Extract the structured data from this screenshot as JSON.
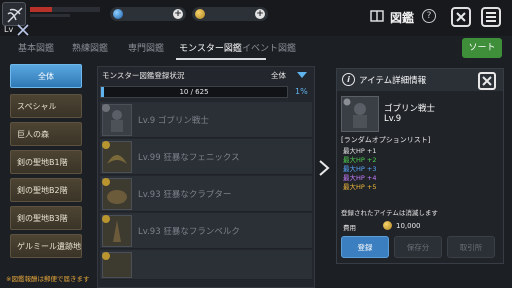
{
  "player": {
    "level_label": "Lv",
    "hp_fraction": 0.32
  },
  "header": {
    "title": "図鑑",
    "help_label": "?"
  },
  "tabs": [
    {
      "label": "基本図鑑"
    },
    {
      "label": "熟練図鑑"
    },
    {
      "label": "専門図鑑"
    },
    {
      "label": "モンスター図鑑"
    },
    {
      "label": "イベント図鑑"
    }
  ],
  "sort_label": "ソート",
  "sidebar": {
    "items": [
      {
        "label": "全体"
      },
      {
        "label": "スペシャル"
      },
      {
        "label": "巨人の森"
      },
      {
        "label": "剣の聖地B1階"
      },
      {
        "label": "剣の聖地B2階"
      },
      {
        "label": "剣の聖地B3階"
      },
      {
        "label": "ゲルミール遺跡地"
      }
    ]
  },
  "collection": {
    "status_label": "モンスター図鑑登録状況",
    "filter_label": "全体",
    "progress_text": "10 / 625",
    "progress_fraction": 0.016,
    "percent": "1%",
    "rows": [
      {
        "name": "Lv.9 ゴブリン戦士"
      },
      {
        "name": "Lv.99 狂暴なフェニックス"
      },
      {
        "name": "Lv.93 狂暴なクラプター"
      },
      {
        "name": "Lv.93 狂暴なフランベルク"
      }
    ]
  },
  "detail": {
    "title": "アイテム詳細情報",
    "item_name": "ゴブリン戦士",
    "item_level": "Lv.9",
    "options_title": "[ランダムオプションリスト]",
    "options": [
      {
        "text": "最大HP +1",
        "color": "#e8e8e8"
      },
      {
        "text": "最大HP +2",
        "color": "#4fd14f"
      },
      {
        "text": "最大HP +3",
        "color": "#5aa8ff"
      },
      {
        "text": "最大HP +4",
        "color": "#c77dff"
      },
      {
        "text": "最大HP +5",
        "color": "#f2b93b"
      }
    ],
    "note": "登録されたアイテムは消滅します",
    "cost_label": "費用",
    "cost_value": "10,000",
    "btn_register": "登録",
    "btn_keep": "保存分",
    "btn_trade": "取引所"
  },
  "footer_note": "※図鑑報酬は郵便で届きます",
  "colors": {
    "accent_blue": "#5fb4ee",
    "sort_green": "#3e8e3a",
    "hp_red": "#b9322a"
  }
}
